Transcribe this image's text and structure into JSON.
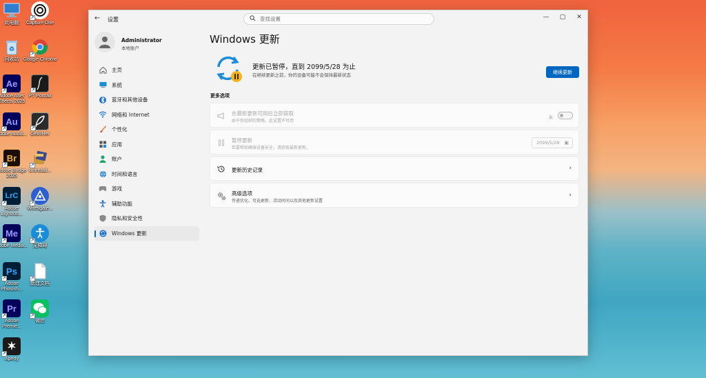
{
  "desktop": {
    "icons": [
      {
        "label": "此电脑",
        "icon": "computer-icon",
        "color": "#2f7fd0"
      },
      {
        "label": "Capture One",
        "icon": "capture-one-icon",
        "color": "#ffffff"
      },
      {
        "label": "回收站",
        "icon": "recycle-bin-icon",
        "color": "#6aa7d8"
      },
      {
        "label": "Google Chrome",
        "icon": "chrome-icon",
        "color": "#ffffff"
      },
      {
        "label": "Adobe After Effects 2025",
        "icon": "after-effects-icon",
        "tile": "Ae",
        "color": "#00005b",
        "fg": "#9999ff"
      },
      {
        "label": "PT Portrait",
        "icon": "pt-portrait-icon",
        "color": "#1a1a1a"
      },
      {
        "label": "Adobe Auditi...",
        "icon": "audition-icon",
        "tile": "Au",
        "color": "#00005b",
        "fg": "#9999ff"
      },
      {
        "label": "GetRHer",
        "icon": "feather-icon",
        "color": "#2b2b2b"
      },
      {
        "label": "Adobe Bridge 2025",
        "icon": "bridge-icon",
        "tile": "Br",
        "color": "#1b0d06",
        "fg": "#e8b14b"
      },
      {
        "label": "Uninstall...",
        "icon": "uninstall-icon",
        "color": "#3a4a8a"
      },
      {
        "label": "Adobe Lightroo...",
        "icon": "lightroom-classic-icon",
        "tile": "LrC",
        "color": "#001e36",
        "fg": "#31a8ff"
      },
      {
        "label": "Wiresgate...",
        "icon": "wiresgate-icon",
        "color": "#2d5fd0"
      },
      {
        "label": "Adobe Media...",
        "icon": "media-encoder-icon",
        "tile": "Me",
        "color": "#00005b",
        "fg": "#9999ff"
      },
      {
        "label": "无障碍",
        "icon": "accessibility-icon",
        "color": "#1a8cd8"
      },
      {
        "label": "Adobe Photosh...",
        "icon": "photoshop-icon",
        "tile": "Ps",
        "color": "#001e36",
        "fg": "#31a8ff"
      },
      {
        "label": "新建文档",
        "icon": "document-icon",
        "color": "#ffffff"
      },
      {
        "label": "Adobe Premie...",
        "icon": "premiere-icon",
        "tile": "Pr",
        "color": "#00005b",
        "fg": "#9999ff"
      },
      {
        "label": "微信",
        "icon": "wechat-icon",
        "color": "#07c160"
      },
      {
        "label": "Aperty",
        "icon": "aperty-icon",
        "color": "#1a1a1a"
      }
    ]
  },
  "window": {
    "title": "设置",
    "search_placeholder": "查找设置",
    "profile": {
      "name": "Administrator",
      "account_type": "本地账户"
    },
    "nav": [
      {
        "label": "主页",
        "icon": "home-icon"
      },
      {
        "label": "系统",
        "icon": "system-icon"
      },
      {
        "label": "蓝牙和其他设备",
        "icon": "bluetooth-icon"
      },
      {
        "label": "网络和 Internet",
        "icon": "network-icon"
      },
      {
        "label": "个性化",
        "icon": "brush-icon"
      },
      {
        "label": "应用",
        "icon": "apps-icon"
      },
      {
        "label": "账户",
        "icon": "account-icon"
      },
      {
        "label": "时间和语言",
        "icon": "globe-clock-icon"
      },
      {
        "label": "游戏",
        "icon": "gamepad-icon"
      },
      {
        "label": "辅助功能",
        "icon": "accessibility-icon"
      },
      {
        "label": "隐私和安全性",
        "icon": "shield-icon"
      },
      {
        "label": "Windows 更新",
        "icon": "update-icon",
        "active": true
      }
    ],
    "page_title": "Windows 更新",
    "status": {
      "title": "更新已暂停，直到 2099/5/28 为止",
      "subtitle": "在继续更新之前，你的设备可能不会保持最新状态",
      "resume_button": "继续更新"
    },
    "more_options_label": "更多选项",
    "options": [
      {
        "title": "在最新更新可用后立即获取",
        "subtitle": "由于你组织的策略，此设置不可用",
        "control": "toggle",
        "toggle_label": "关",
        "disabled": true,
        "icon": "megaphone-icon"
      },
      {
        "title": "暂停更新",
        "subtitle": "若要帮助确保设备安全，请获取最新更新。",
        "control": "date",
        "date_value": "2099/5/28",
        "disabled": true,
        "icon": "pause-icon"
      },
      {
        "title": "更新历史记录",
        "subtitle": "",
        "control": "chevron",
        "disabled": false,
        "icon": "history-icon"
      },
      {
        "title": "高级选项",
        "subtitle": "传递优化、可选更新、活动时间以及其他更新设置",
        "control": "chevron",
        "disabled": false,
        "icon": "gears-icon"
      }
    ],
    "accent_color": "#0067c0"
  }
}
